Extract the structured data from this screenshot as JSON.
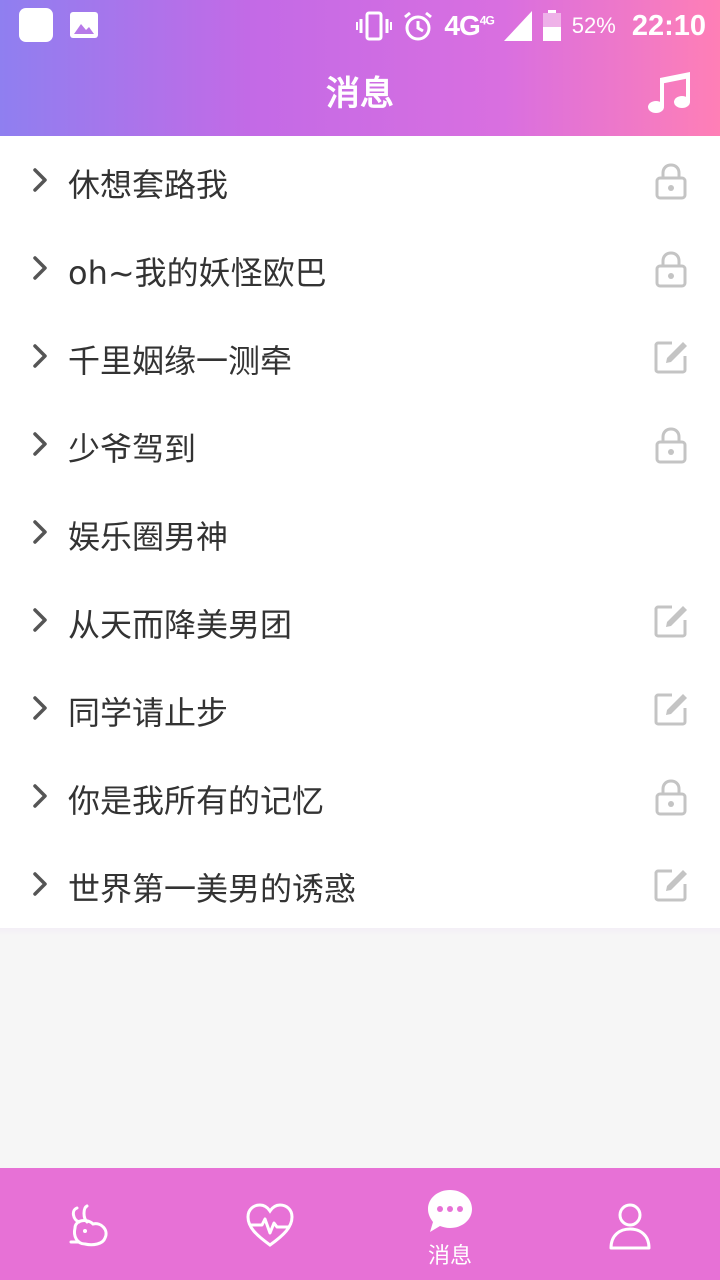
{
  "status_bar": {
    "network": "4G",
    "network_small": "4G",
    "battery": "52%",
    "time": "22:10"
  },
  "header": {
    "title": "消息",
    "music_icon": "music-note-icon"
  },
  "list": {
    "items": [
      {
        "label": "休想套路我",
        "icon": "lock-icon"
      },
      {
        "label": "oh~我的妖怪欧巴",
        "icon": "lock-icon"
      },
      {
        "label": "千里姻缘一测牵",
        "icon": "edit-icon"
      },
      {
        "label": "少爷驾到",
        "icon": "lock-icon"
      },
      {
        "label": "娱乐圈男神",
        "icon": ""
      },
      {
        "label": "从天而降美男团",
        "icon": "edit-icon"
      },
      {
        "label": "同学请止步",
        "icon": "edit-icon"
      },
      {
        "label": "你是我所有的记忆",
        "icon": "lock-icon"
      },
      {
        "label": "世界第一美男的诱惑",
        "icon": "edit-icon"
      }
    ]
  },
  "bottom_nav": {
    "tabs": [
      {
        "icon": "rabbit-icon",
        "label": ""
      },
      {
        "icon": "heartbeat-icon",
        "label": ""
      },
      {
        "icon": "chat-bubble-icon",
        "label": "消息"
      },
      {
        "icon": "person-icon",
        "label": ""
      }
    ]
  },
  "colors": {
    "header_gradient_start": "#8f7ff0",
    "header_gradient_end": "#ff7fb6",
    "bottom_bar": "#e771d6",
    "list_text": "#333333",
    "icon_gray": "#c4c4c4"
  }
}
